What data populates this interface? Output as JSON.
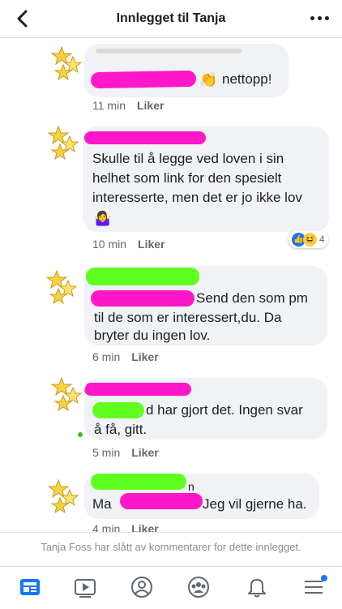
{
  "header": {
    "title": "Innlegget til Tanja"
  },
  "comments": [
    {
      "name": "",
      "text": "nettopp!",
      "time": "11 min",
      "like_label": "Liker"
    },
    {
      "name": "",
      "text": "Skulle til å legge ved loven i sin helhet som link for den spesielt interesserte, men det er jo ikke lov",
      "time": "10 min",
      "like_label": "Liker",
      "reactions": {
        "count": "4"
      }
    },
    {
      "name": "",
      "text_l1": "Send den som pm",
      "text_l2": "til de som er interessert,du. Da",
      "text_l3": "bryter du ingen lov.",
      "time": "6 min",
      "like_label": "Liker"
    },
    {
      "name": "",
      "text_l1": "d har gjort det. Ingen svar",
      "text_l2": "å få, gitt.",
      "time": "5 min",
      "like_label": "Liker"
    },
    {
      "name": "",
      "text_l1": "n",
      "text_l2": "Jeg vil gjerne ha.",
      "text_prefix": "Ma",
      "time": "4 min",
      "like_label": "Liker"
    }
  ],
  "footer": {
    "closed_note": "Tanja Foss har slått av kommentarer for dette innlegget."
  },
  "tabbar": {
    "tabs": [
      "news-feed",
      "watch",
      "profile",
      "groups",
      "notifications",
      "menu"
    ]
  },
  "colors": {
    "accent": "#1877f2",
    "magenta_scribble": "#ff17c9",
    "green_scribble": "#61ff1f"
  }
}
